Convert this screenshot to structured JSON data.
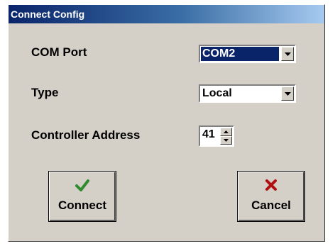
{
  "window": {
    "title": "Connect Config"
  },
  "fields": {
    "com_port": {
      "label": "COM Port",
      "value": "COM2"
    },
    "type": {
      "label": "Type",
      "value": "Local"
    },
    "controller_address": {
      "label": "Controller Address",
      "value": "41"
    }
  },
  "buttons": {
    "connect": {
      "label": "Connect",
      "icon": "checkmark-icon",
      "color": "#2e8b2e"
    },
    "cancel": {
      "label": "Cancel",
      "icon": "x-icon",
      "color": "#b01010"
    }
  },
  "colors": {
    "selection": "#0a246a",
    "face": "#d4d0c8"
  }
}
